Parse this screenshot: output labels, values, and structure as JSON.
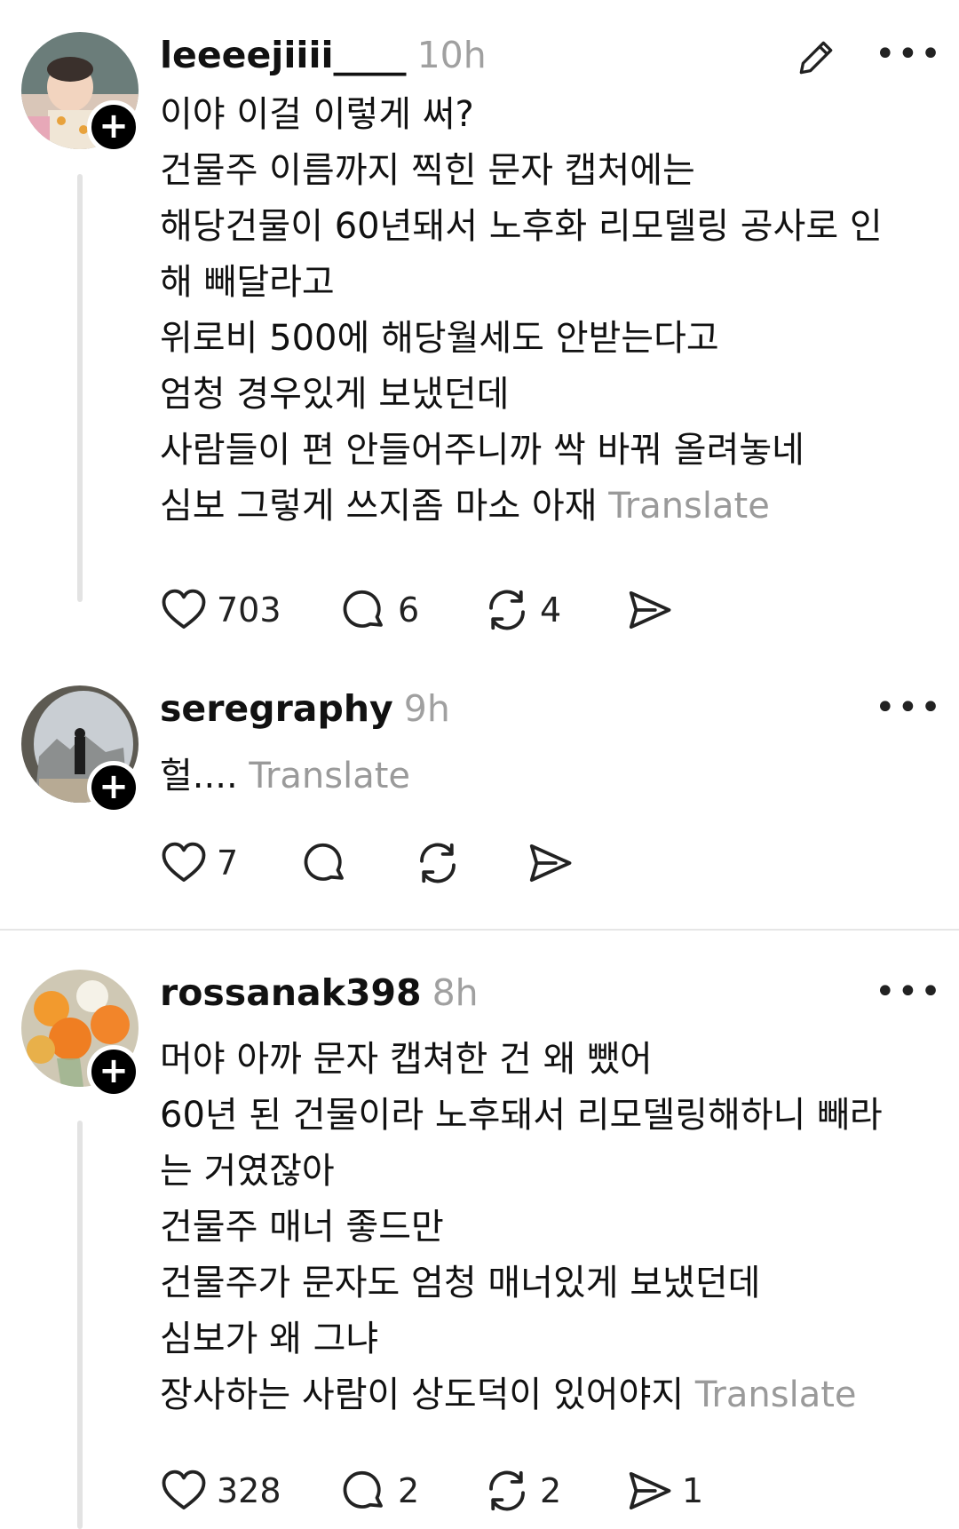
{
  "posts": [
    {
      "username": "leeeejiiii____",
      "time": "10h",
      "lines": [
        "이야 이걸 이렇게 써?",
        "건물주 이름까지 찍힌 문자 캡처에는",
        "해당건물이 60년돼서 노후화 리모델링 공사로 인",
        "해 빼달라고",
        "위로비 500에 해당월세도 안받는다고",
        "엄청 경우있게 보냈던데",
        "사람들이 편 안들어주니까 싹 바꿔 올려놓네",
        "심보 그렇게 쓰지좀 마소 아재"
      ],
      "translate": "Translate",
      "likes": "703",
      "replies": "6",
      "reposts": "4",
      "shares": ""
    },
    {
      "username": "seregraphy",
      "time": "9h",
      "lines": [
        "헐...."
      ],
      "translate": "Translate",
      "likes": "7",
      "replies": "",
      "reposts": "",
      "shares": ""
    },
    {
      "username": "rossanak398",
      "time": "8h",
      "lines": [
        "머야 아까 문자 캡쳐한 건 왜 뺐어",
        "60년 된 건물이라 노후돼서 리모델링해하니 빼라",
        "는 거였잖아",
        "건물주 매너 좋드만",
        "건물주가 문자도 엄청 매너있게 보냈던데",
        "심보가 왜 그냐",
        "장사하는 사람이 상도덕이 있어야지"
      ],
      "translate": "Translate",
      "likes": "328",
      "replies": "2",
      "reposts": "2",
      "shares": "1"
    }
  ],
  "icons": {
    "more": "more-horizontal-icon",
    "edit": "pencil-icon",
    "like": "heart-icon",
    "reply": "comment-icon",
    "repost": "repost-icon",
    "share": "send-icon",
    "follow": "plus-icon"
  },
  "colors": {
    "text": "#111111",
    "muted": "#9a9a9a",
    "divider": "#e6e6e6"
  }
}
